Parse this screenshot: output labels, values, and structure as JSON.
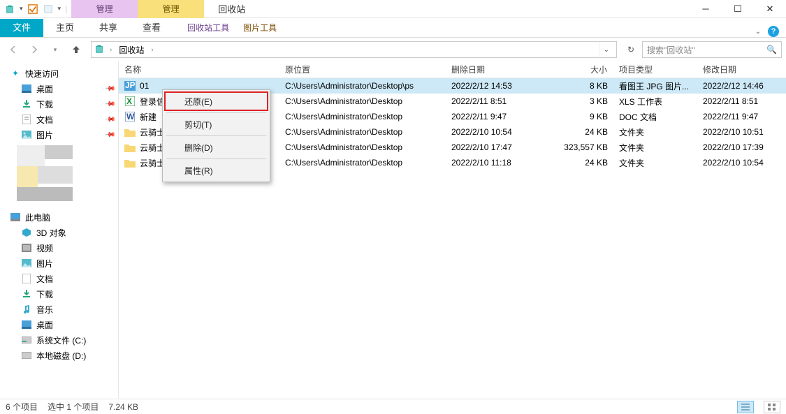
{
  "window": {
    "title": "回收站",
    "manage1": "管理",
    "manage2": "管理"
  },
  "ribbon": {
    "file": "文件",
    "home": "主页",
    "share": "共享",
    "view": "查看",
    "ctx1": "回收站工具",
    "ctx2": "图片工具"
  },
  "nav": {
    "crumb": "回收站",
    "search_placeholder": "搜索\"回收站\""
  },
  "sidebar": {
    "quick": "快速访问",
    "desktop": "桌面",
    "downloads": "下载",
    "documents": "文档",
    "pictures": "图片",
    "thispc": "此电脑",
    "obj3d": "3D 对象",
    "videos": "视频",
    "pictures2": "图片",
    "documents2": "文档",
    "downloads2": "下载",
    "music": "音乐",
    "desktop2": "桌面",
    "sysc": "系统文件 (C:)",
    "diskd": "本地磁盘 (D:)"
  },
  "columns": {
    "name": "名称",
    "orig": "原位置",
    "deleted": "删除日期",
    "size": "大小",
    "type": "项目类型",
    "modified": "修改日期"
  },
  "rows": {
    "r0": {
      "name": "01",
      "orig": "C:\\Users\\Administrator\\Desktop\\ps",
      "del": "2022/2/12 14:53",
      "size": "8 KB",
      "type": "看图王 JPG 图片...",
      "mod": "2022/2/12 14:46",
      "icon": "jpg"
    },
    "r1": {
      "name": "登录信",
      "orig": "C:\\Users\\Administrator\\Desktop",
      "del": "2022/2/11 8:51",
      "size": "3 KB",
      "type": "XLS 工作表",
      "mod": "2022/2/11 8:51",
      "icon": "xls"
    },
    "r2": {
      "name": "新建",
      "orig": "C:\\Users\\Administrator\\Desktop",
      "del": "2022/2/11 9:47",
      "size": "9 KB",
      "type": "DOC 文档",
      "mod": "2022/2/11 9:47",
      "icon": "doc"
    },
    "r3": {
      "name": "云骑士",
      "orig": "C:\\Users\\Administrator\\Desktop",
      "del": "2022/2/10 10:54",
      "size": "24 KB",
      "type": "文件夹",
      "mod": "2022/2/10 10:51",
      "icon": "folder"
    },
    "r4": {
      "name": "云骑士",
      "orig": "C:\\Users\\Administrator\\Desktop",
      "del": "2022/2/10 17:47",
      "size": "323,557 KB",
      "type": "文件夹",
      "mod": "2022/2/10 17:39",
      "icon": "folder"
    },
    "r5": {
      "name": "云骑士",
      "orig": "C:\\Users\\Administrator\\Desktop",
      "del": "2022/2/10 11:18",
      "size": "24 KB",
      "type": "文件夹",
      "mod": "2022/2/10 10:54",
      "icon": "folder"
    }
  },
  "context": {
    "restore": "还原(E)",
    "cut": "剪切(T)",
    "delete": "删除(D)",
    "props": "属性(R)"
  },
  "status": {
    "count": "6 个项目",
    "selected": "选中 1 个项目",
    "size": "7.24 KB"
  }
}
